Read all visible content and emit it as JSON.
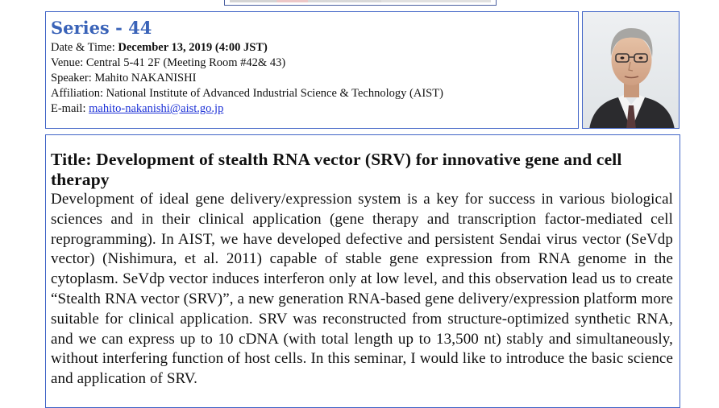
{
  "series": {
    "title": "Series - 44"
  },
  "info": {
    "datetime_label": "Date & Time: ",
    "datetime_value": "December 13, 2019 (4:00 JST)",
    "venue": "Venue: Central 5-41 2F (Meeting Room #42& 43)",
    "speaker": "Speaker: Mahito NAKANISHI",
    "affiliation": "Affiliation: National Institute of Advanced Industrial Science & Technology (AIST)",
    "email_label": "E-mail: ",
    "email": "mahito-nakanishi@aist.go.jp"
  },
  "talk": {
    "title": "Title: Development of stealth RNA vector (SRV) for innovative gene and cell therapy",
    "abstract": "Development of ideal gene delivery/expression system is a key for success in various biological sciences and in their clinical application (gene therapy and transcription factor-mediated cell reprogramming). In AIST, we have developed defective and persistent Sendai virus vector (SeVdp vector) (Nishimura, et al. 2011) capable of stable gene expression from RNA genome in the cytoplasm. SeVdp vector induces interferon only at low level, and this observation lead us to create “Stealth RNA vector (SRV)”, a new generation RNA-based gene delivery/expression platform more suitable for clinical application. SRV was reconstructed from structure-optimized synthetic RNA, and we can express up to 10 cDNA (with total length up to 13,500 nt) stably and simultaneously, without interfering function of host cells. In this seminar, I would like to introduce the basic science and application of SRV."
  }
}
